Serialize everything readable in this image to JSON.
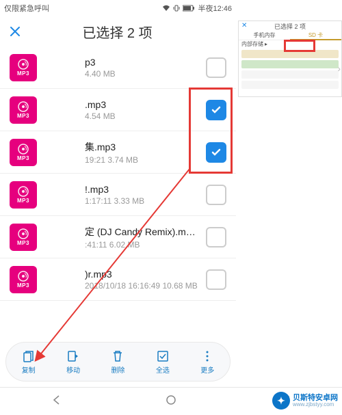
{
  "status": {
    "left": "仅限紧急呼叫",
    "time": "半夜12:46"
  },
  "header": {
    "title": "已选择 2 项"
  },
  "files": [
    {
      "name": "p3",
      "meta": "4.40 MB",
      "checked": false
    },
    {
      "name": ".mp3",
      "meta": "4.54 MB",
      "checked": true
    },
    {
      "name": "集.mp3",
      "meta": "3.74 MB",
      "meta_prefix": "19:21",
      "checked": true
    },
    {
      "name": "!.mp3",
      "meta": "1:17:11 3.33 MB",
      "checked": false
    },
    {
      "name": "定 (DJ Candy Remix).m…",
      "meta": ":41:11 6.02 MB",
      "checked": false
    },
    {
      "name": ")r.mp3",
      "meta": "2018/10/18 16:16:49 10.68 MB",
      "checked": false
    }
  ],
  "bottom": {
    "copy": "复制",
    "move": "移动",
    "delete": "删除",
    "select_all": "全选",
    "more": "更多"
  },
  "inset": {
    "title": "已选择 2 项",
    "tab1": "手机内存",
    "tab2": "SD 卡",
    "path": "内部存储"
  },
  "brand": {
    "cn": "贝斯特安卓网",
    "en": "www.zjbstyy.com"
  }
}
